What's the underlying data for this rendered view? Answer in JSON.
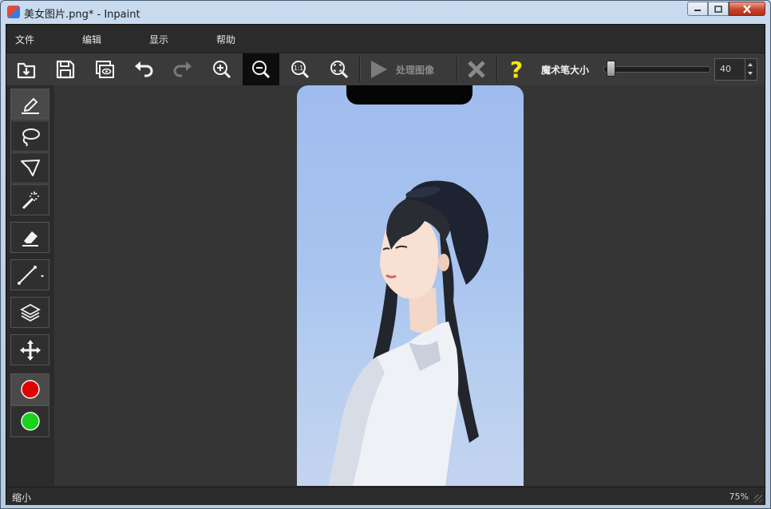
{
  "window": {
    "title": "美女图片.png* - Inpaint",
    "app_icon": "inpaint-app-icon",
    "controls": [
      "minimize-icon",
      "maximize-icon",
      "close-icon"
    ]
  },
  "menu": {
    "items": [
      "文件",
      "编辑",
      "显示",
      "帮助"
    ]
  },
  "toolbar": {
    "buttons": [
      {
        "icon": "open-file-icon",
        "enabled": true
      },
      {
        "icon": "save-icon",
        "enabled": true
      },
      {
        "icon": "save-as-icon",
        "enabled": true
      },
      {
        "icon": "undo-icon",
        "enabled": true
      },
      {
        "icon": "redo-icon",
        "enabled": false
      },
      {
        "icon": "zoom-in-icon",
        "enabled": true
      },
      {
        "icon": "zoom-out-icon",
        "enabled": true,
        "active": true
      },
      {
        "icon": "actual-size-icon",
        "enabled": true
      },
      {
        "icon": "fit-to-window-icon",
        "enabled": true
      }
    ],
    "process_label": "处理图像",
    "process_icon": "play-icon",
    "cancel_icon": "cancel-x-icon",
    "help_icon": "help-question-icon",
    "brush_size_label": "魔术笔大小",
    "brush_size_value": "40",
    "brush_size_fraction": 0.05
  },
  "tools": [
    {
      "name": "marker",
      "icon": "marker-icon",
      "selected": true
    },
    {
      "name": "lasso",
      "icon": "lasso-icon",
      "selected": false
    },
    {
      "name": "polygonal-lasso",
      "icon": "polygonal-lasso-icon",
      "selected": false
    },
    {
      "name": "magic-wand",
      "icon": "magic-wand-icon",
      "selected": false
    },
    {
      "name": "eraser",
      "icon": "eraser-icon",
      "selected": false
    },
    {
      "name": "line",
      "icon": "line-tool-icon",
      "selected": false
    },
    {
      "name": "layers",
      "icon": "layers-icon",
      "selected": false
    },
    {
      "name": "move",
      "icon": "move-icon",
      "selected": false
    },
    {
      "name": "red-marker-color",
      "icon": "red-circle-icon",
      "color": "#e00000"
    },
    {
      "name": "green-marker-color",
      "icon": "green-circle-icon",
      "color": "#19d219"
    }
  ],
  "status": {
    "left": "缩小",
    "zoom": "75%"
  },
  "colors": {
    "dark_bg": "#2b2b2b",
    "canvas_bg": "#353535",
    "help_yellow": "#ffe600",
    "red_marker": "#e00000",
    "green_marker": "#19d219"
  }
}
